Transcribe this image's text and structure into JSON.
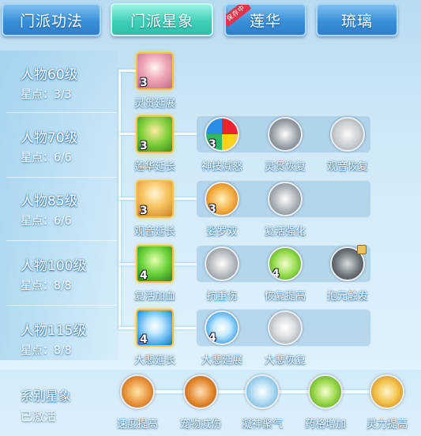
{
  "tabs": [
    {
      "label": "门派功法",
      "style": "blue"
    },
    {
      "label": "门派星象",
      "style": "teal",
      "active": true
    },
    {
      "label": "莲华",
      "style": "blue",
      "ribbon": "保存中"
    },
    {
      "label": "琉璃",
      "style": "blue"
    }
  ],
  "levels": [
    {
      "title": "人物60级",
      "stars": "星点：3/3"
    },
    {
      "title": "人物70级",
      "stars": "星点：6/6"
    },
    {
      "title": "人物85级",
      "stars": "星点：6/6"
    },
    {
      "title": "人物100级",
      "stars": "星点：8/8"
    },
    {
      "title": "人物115级",
      "stars": "星点：8/8"
    }
  ],
  "skills": {
    "r1": [
      {
        "name": "灵贯延展",
        "count": "3"
      }
    ],
    "r2": [
      {
        "name": "莲华延长",
        "count": "3"
      },
      {
        "name": "神技减怒",
        "count": "3"
      },
      {
        "name": "灵贯恢复",
        "count": ""
      },
      {
        "name": "观音恢复",
        "count": ""
      }
    ],
    "r3": [
      {
        "name": "观音延长",
        "count": "3"
      },
      {
        "name": "娑罗双",
        "count": "3"
      },
      {
        "name": "复活强化",
        "count": ""
      }
    ],
    "r4": [
      {
        "name": "复活加血",
        "count": "4"
      },
      {
        "name": "抗重伤",
        "count": ""
      },
      {
        "name": "恢复提高",
        "count": "4"
      },
      {
        "name": "抱元触发",
        "count": ""
      }
    ],
    "r5": [
      {
        "name": "大悲延长",
        "count": "4"
      },
      {
        "name": "大悲延展",
        "count": "4"
      },
      {
        "name": "大悲恢复",
        "count": ""
      }
    ]
  },
  "system": {
    "title": "系别星象",
    "status": "已激活",
    "items": [
      "速度提高",
      "宠物减伤",
      "凝神聚气",
      "药格增加",
      "灵力提高"
    ]
  },
  "icons": [
    "lock-icon"
  ]
}
